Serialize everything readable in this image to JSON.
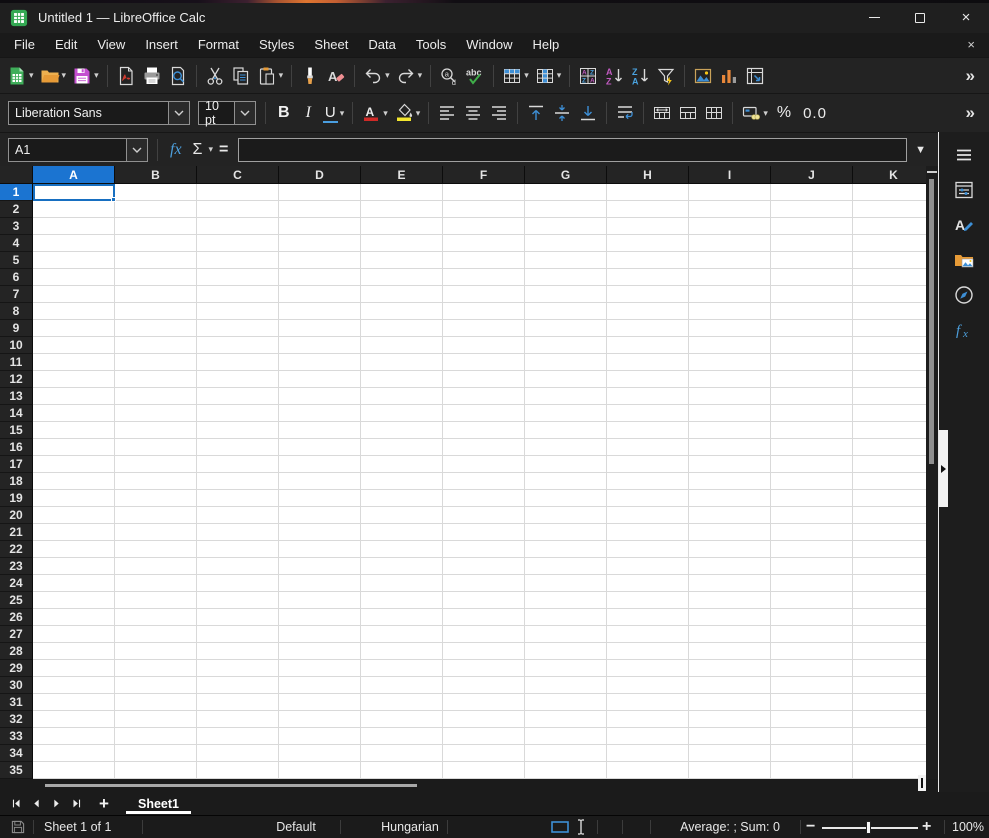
{
  "window": {
    "title": "Untitled 1 — LibreOffice Calc"
  },
  "titlebar": {
    "minimize_label": "",
    "maximize_label": "",
    "close_label": "×"
  },
  "menubar": {
    "items": [
      "File",
      "Edit",
      "View",
      "Insert",
      "Format",
      "Styles",
      "Sheet",
      "Data",
      "Tools",
      "Window",
      "Help"
    ],
    "close_document_label": "×"
  },
  "standard_toolbar": {
    "overflow_label": "»",
    "buttons": [
      {
        "name": "new-document",
        "dropdown": true
      },
      {
        "name": "open-folder",
        "dropdown": true
      },
      {
        "name": "save",
        "dropdown": true
      },
      {
        "sep": true
      },
      {
        "name": "export-pdf"
      },
      {
        "name": "print"
      },
      {
        "name": "print-preview"
      },
      {
        "sep": true
      },
      {
        "name": "cut"
      },
      {
        "name": "copy"
      },
      {
        "name": "paste",
        "dropdown": true
      },
      {
        "sep": true
      },
      {
        "name": "clone-formatting"
      },
      {
        "name": "clear-formatting"
      },
      {
        "sep": true
      },
      {
        "name": "undo",
        "dropdown": true
      },
      {
        "name": "redo",
        "dropdown": true
      },
      {
        "sep": true
      },
      {
        "name": "find-replace"
      },
      {
        "name": "spelling"
      },
      {
        "sep": true
      },
      {
        "name": "insert-row",
        "dropdown": true
      },
      {
        "name": "insert-column",
        "dropdown": true
      },
      {
        "sep": true
      },
      {
        "name": "sort"
      },
      {
        "name": "sort-ascending"
      },
      {
        "name": "sort-descending"
      },
      {
        "name": "autofilter"
      },
      {
        "sep": true
      },
      {
        "name": "insert-image"
      },
      {
        "name": "insert-chart"
      },
      {
        "name": "pivot-table"
      }
    ]
  },
  "formatting_toolbar": {
    "font_name": "Liberation Sans",
    "font_size": "10 pt",
    "overflow_label": "»",
    "buttons": [
      {
        "name": "bold",
        "text": "B",
        "cls": "g-bold"
      },
      {
        "name": "italic",
        "text": "I",
        "cls": "g-italic"
      },
      {
        "name": "underline",
        "text": "U",
        "cls": "g-underline",
        "dropdown": true
      },
      {
        "sep": true
      },
      {
        "name": "font-color",
        "icon": "font-color",
        "dropdown": true
      },
      {
        "name": "highlighting-color",
        "icon": "highlight-color",
        "dropdown": true
      },
      {
        "sep": true
      },
      {
        "name": "align-left",
        "icon": "align-left"
      },
      {
        "name": "align-center",
        "icon": "align-center"
      },
      {
        "name": "align-right",
        "icon": "align-right"
      },
      {
        "sep": true
      },
      {
        "name": "align-top",
        "icon": "align-top"
      },
      {
        "name": "center-vertically",
        "icon": "center-vertically"
      },
      {
        "name": "align-bottom",
        "icon": "align-bottom"
      },
      {
        "sep": true
      },
      {
        "name": "wrap-text",
        "icon": "wrap-text"
      },
      {
        "sep": true
      },
      {
        "name": "merge-and-center-cells",
        "icon": "merge-center"
      },
      {
        "name": "merge-cells",
        "icon": "merge-cells"
      },
      {
        "name": "unmerge-cells",
        "icon": "unmerge-cells"
      },
      {
        "sep": true
      },
      {
        "name": "format-as-currency",
        "icon": "currency",
        "dropdown": true
      },
      {
        "name": "format-as-percent",
        "text": "%",
        "cls": "g-percent"
      },
      {
        "name": "format-as-number",
        "text": "0.0",
        "cls": "g-number"
      }
    ]
  },
  "formula_bar": {
    "cell_reference": "A1",
    "function_wizard_label": "fx",
    "select_function_label": "Σ",
    "formula_label": "=",
    "formula_value": ""
  },
  "grid": {
    "columns": [
      "A",
      "B",
      "C",
      "D",
      "E",
      "F",
      "G",
      "H",
      "I",
      "J",
      "K"
    ],
    "rows": [
      1,
      2,
      3,
      4,
      5,
      6,
      7,
      8,
      9,
      10,
      11,
      12,
      13,
      14,
      15,
      16,
      17,
      18,
      19,
      20,
      21,
      22,
      23,
      24,
      25,
      26,
      27,
      28,
      29,
      30,
      31,
      32,
      33,
      34,
      35
    ],
    "selected_cell": "A1",
    "selected_column": "A",
    "selected_row": 1
  },
  "sheet_navigation": {
    "buttons": [
      "first-sheet",
      "previous-sheet",
      "next-sheet",
      "last-sheet"
    ],
    "add_label": "+",
    "tabs": [
      {
        "label": "Sheet1",
        "active": true
      }
    ]
  },
  "sidebar": {
    "tabs": [
      "sidebar-menu",
      "properties",
      "styles",
      "gallery",
      "navigator",
      "functions"
    ]
  },
  "status_bar": {
    "sheet_position": "Sheet 1 of 1",
    "page_style": "Default",
    "language": "Hungarian",
    "selection_summary": "Average: ; Sum: 0",
    "zoom_out_label": "−",
    "zoom_in_label": "+",
    "zoom_level": "100%"
  },
  "colors": {
    "accent_blue": "#1b74d1",
    "selection_border": "#176fc1",
    "header_background": "#242424",
    "chrome_background": "#212121",
    "cell_background": "#ffffff",
    "gridline": "#d9d9d9"
  }
}
